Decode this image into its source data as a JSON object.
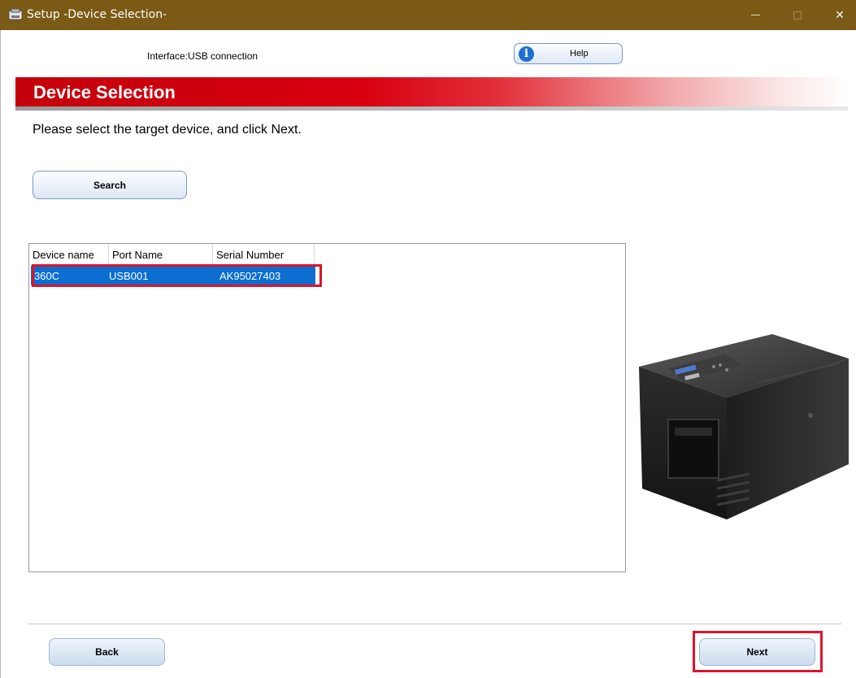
{
  "window": {
    "title": "Setup -Device Selection-",
    "controls": {
      "minimize": "—",
      "maximize": "□",
      "close": "✕"
    }
  },
  "header": {
    "interface_label": "Interface:USB connection",
    "help_label": "Help",
    "help_icon": "info-icon"
  },
  "banner": {
    "title": "Device Selection"
  },
  "instruction": "Please select the target device, and click Next.",
  "search_label": "Search",
  "device_table": {
    "columns": [
      "Device name",
      "Port Name",
      "Serial Number"
    ],
    "rows": [
      {
        "device_name": "360C",
        "port_name": "USB001",
        "serial_number": "AK95027403",
        "selected": true
      }
    ]
  },
  "footer": {
    "back_label": "Back",
    "next_label": "Next"
  },
  "colors": {
    "titlebar": "#7a5a14",
    "banner_red": "#d80010",
    "selection_blue": "#0c6ed0",
    "highlight_red": "#e0132b"
  }
}
